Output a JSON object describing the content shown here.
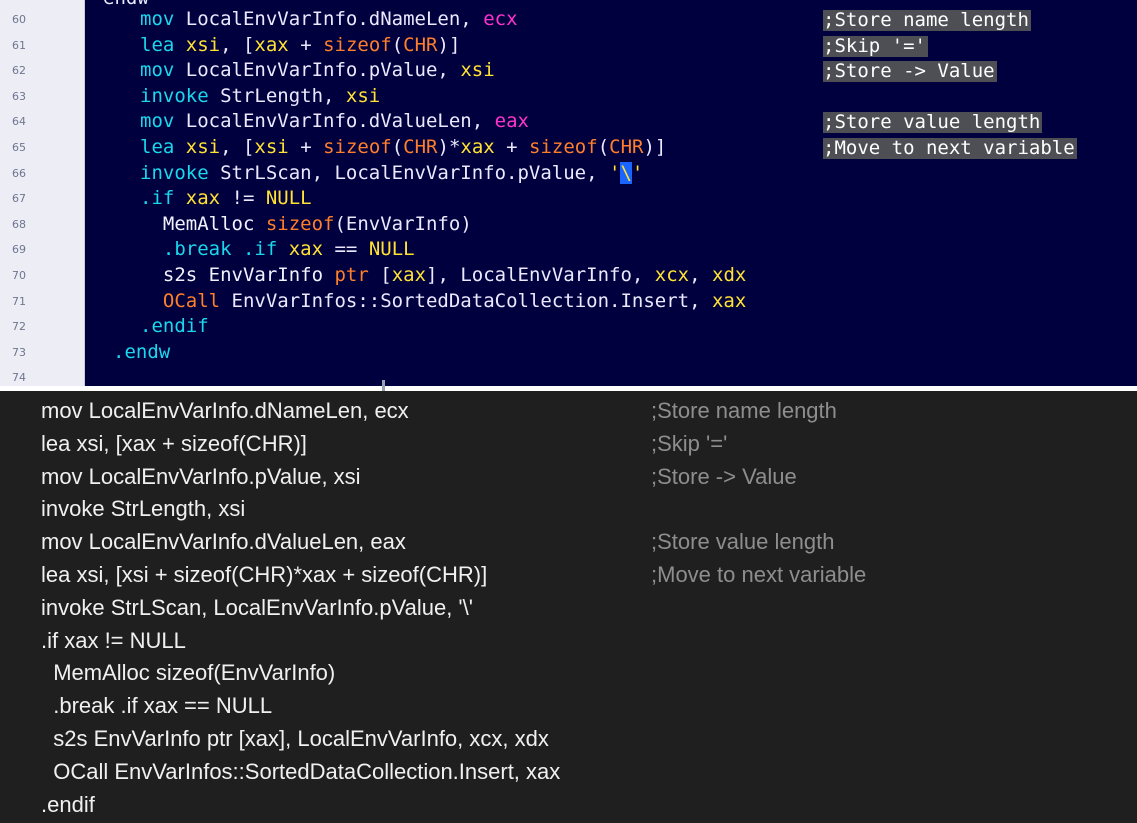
{
  "top_pane": {
    "line_numbers": [
      "60",
      "61",
      "62",
      "63",
      "64",
      "65",
      "66",
      "67",
      "68",
      "69",
      "70",
      "71",
      "72",
      "73",
      "74"
    ],
    "cut_fragment": "endw",
    "lines": [
      {
        "tokens": [
          {
            "t": "mov ",
            "c": "k-cyan"
          },
          {
            "t": "LocalEnvVarInfo.dNameLen, ",
            "c": "k-white"
          },
          {
            "t": "ecx",
            "c": "k-mag"
          }
        ],
        "comment": ";Store name length"
      },
      {
        "tokens": [
          {
            "t": "lea ",
            "c": "k-cyan"
          },
          {
            "t": "xsi",
            "c": "k-yellow"
          },
          {
            "t": ", [",
            "c": "k-white"
          },
          {
            "t": "xax",
            "c": "k-yellow"
          },
          {
            "t": " + ",
            "c": "k-white"
          },
          {
            "t": "sizeof",
            "c": "k-orange"
          },
          {
            "t": "(",
            "c": "k-white"
          },
          {
            "t": "CHR",
            "c": "k-orange"
          },
          {
            "t": ")]",
            "c": "k-white"
          }
        ],
        "comment": ";Skip '='"
      },
      {
        "tokens": [
          {
            "t": "mov ",
            "c": "k-cyan"
          },
          {
            "t": "LocalEnvVarInfo.pValue, ",
            "c": "k-white"
          },
          {
            "t": "xsi",
            "c": "k-yellow"
          }
        ],
        "comment": ";Store -> Value"
      },
      {
        "tokens": [
          {
            "t": "invoke ",
            "c": "k-cyan"
          },
          {
            "t": "StrLength, ",
            "c": "k-white"
          },
          {
            "t": "xsi",
            "c": "k-yellow"
          }
        ],
        "comment": ""
      },
      {
        "tokens": [
          {
            "t": "mov ",
            "c": "k-cyan"
          },
          {
            "t": "LocalEnvVarInfo.dValueLen, ",
            "c": "k-white"
          },
          {
            "t": "eax",
            "c": "k-mag"
          }
        ],
        "comment": ";Store value length"
      },
      {
        "tokens": [
          {
            "t": "lea ",
            "c": "k-cyan"
          },
          {
            "t": "xsi",
            "c": "k-yellow"
          },
          {
            "t": ", [",
            "c": "k-white"
          },
          {
            "t": "xsi",
            "c": "k-yellow"
          },
          {
            "t": " + ",
            "c": "k-white"
          },
          {
            "t": "sizeof",
            "c": "k-orange"
          },
          {
            "t": "(",
            "c": "k-white"
          },
          {
            "t": "CHR",
            "c": "k-orange"
          },
          {
            "t": ")*",
            "c": "k-white"
          },
          {
            "t": "xax",
            "c": "k-yellow"
          },
          {
            "t": " + ",
            "c": "k-white"
          },
          {
            "t": "sizeof",
            "c": "k-orange"
          },
          {
            "t": "(",
            "c": "k-white"
          },
          {
            "t": "CHR",
            "c": "k-orange"
          },
          {
            "t": ")]",
            "c": "k-white"
          }
        ],
        "comment": ";Move to next variable"
      },
      {
        "tokens": [
          {
            "t": "invoke ",
            "c": "k-cyan"
          },
          {
            "t": "StrLScan, LocalEnvVarInfo.pValue, ",
            "c": "k-white"
          },
          {
            "t": "'",
            "c": "k-yellow"
          },
          {
            "t": "\\",
            "c": "sel-char"
          },
          {
            "t": "'",
            "c": "k-yellow"
          }
        ],
        "comment": ""
      },
      {
        "tokens": [
          {
            "t": ".if ",
            "c": "k-cyan"
          },
          {
            "t": "xax",
            "c": "k-yellow"
          },
          {
            "t": " != ",
            "c": "k-white"
          },
          {
            "t": "NULL",
            "c": "k-yellow"
          }
        ],
        "comment": ""
      },
      {
        "tokens": [
          {
            "t": "  MemAlloc ",
            "c": "k-plain"
          },
          {
            "t": "sizeof",
            "c": "k-orange"
          },
          {
            "t": "(EnvVarInfo)",
            "c": "k-white"
          }
        ],
        "comment": ""
      },
      {
        "tokens": [
          {
            "t": "  .break .if ",
            "c": "k-cyan"
          },
          {
            "t": "xax",
            "c": "k-yellow"
          },
          {
            "t": " == ",
            "c": "k-white"
          },
          {
            "t": "NULL",
            "c": "k-yellow"
          }
        ],
        "comment": ""
      },
      {
        "tokens": [
          {
            "t": "  s2s EnvVarInfo ",
            "c": "k-plain"
          },
          {
            "t": "ptr",
            "c": "k-orange"
          },
          {
            "t": " [",
            "c": "k-white"
          },
          {
            "t": "xax",
            "c": "k-yellow"
          },
          {
            "t": "], LocalEnvVarInfo, ",
            "c": "k-white"
          },
          {
            "t": "xcx",
            "c": "k-yellow"
          },
          {
            "t": ", ",
            "c": "k-white"
          },
          {
            "t": "xdx",
            "c": "k-yellow"
          }
        ],
        "comment": ""
      },
      {
        "tokens": [
          {
            "t": "  ",
            "c": "k-plain"
          },
          {
            "t": "OCall",
            "c": "k-orange"
          },
          {
            "t": " EnvVarInfos::SortedDataCollection.Insert, ",
            "c": "k-white"
          },
          {
            "t": "xax",
            "c": "k-yellow"
          }
        ],
        "comment": ""
      },
      {
        "tokens": [
          {
            "t": ".endif",
            "c": "k-cyan"
          }
        ],
        "comment": ""
      },
      {
        "tokens": [
          {
            "t": ".endw",
            "c": "k-cyan",
            "indent": -1
          }
        ],
        "comment": ""
      },
      {
        "tokens": [],
        "comment": ""
      }
    ]
  },
  "bottom_pane": {
    "lines": [
      {
        "code": "mov LocalEnvVarInfo.dNameLen, ecx",
        "comment": ";Store name length"
      },
      {
        "code": "lea xsi, [xax + sizeof(CHR)]",
        "comment": ";Skip '='"
      },
      {
        "code": "mov LocalEnvVarInfo.pValue, xsi",
        "comment": ";Store -> Value"
      },
      {
        "code": "invoke StrLength, xsi",
        "comment": ""
      },
      {
        "code": "mov LocalEnvVarInfo.dValueLen, eax",
        "comment": ";Store value length"
      },
      {
        "code": "lea xsi, [xsi + sizeof(CHR)*xax + sizeof(CHR)]",
        "comment": ";Move to next variable"
      },
      {
        "code": "invoke StrLScan, LocalEnvVarInfo.pValue, '\\'",
        "comment": ""
      },
      {
        "code": ".if xax != NULL",
        "comment": ""
      },
      {
        "code": "  MemAlloc sizeof(EnvVarInfo)",
        "comment": ""
      },
      {
        "code": "  .break .if xax == NULL",
        "comment": ""
      },
      {
        "code": "  s2s EnvVarInfo ptr [xax], LocalEnvVarInfo, xcx, xdx",
        "comment": ""
      },
      {
        "code": "  OCall EnvVarInfos::SortedDataCollection.Insert, xax",
        "comment": ""
      },
      {
        "code": ".endif",
        "comment": ""
      }
    ]
  }
}
